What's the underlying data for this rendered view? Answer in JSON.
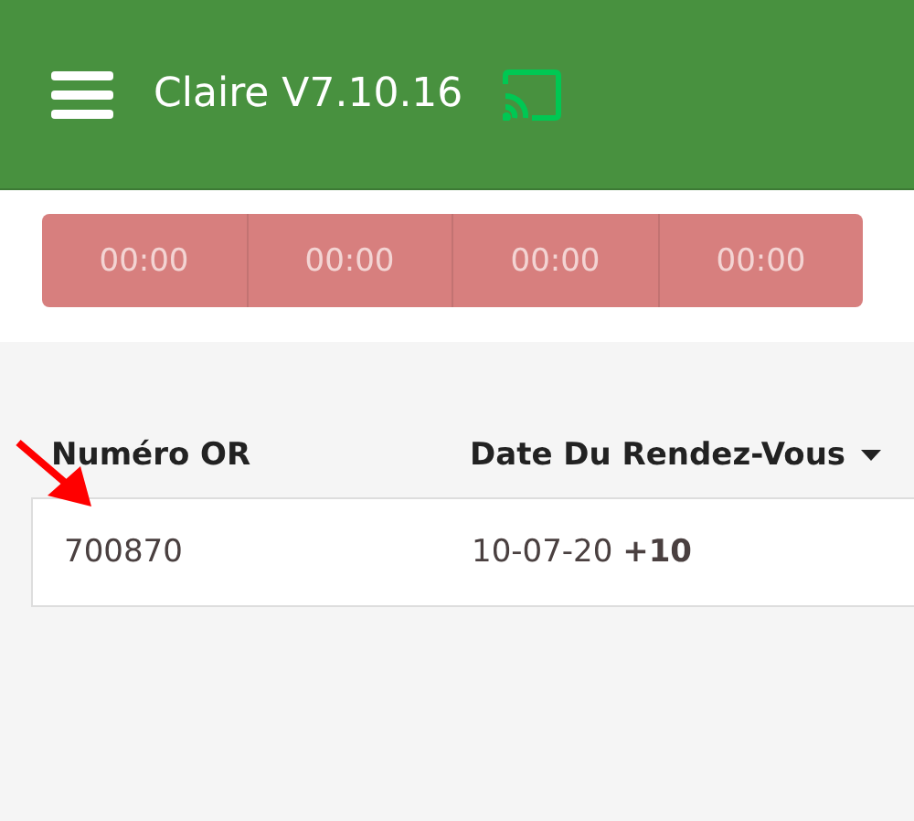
{
  "app_bar": {
    "title": "Claire V7.10.16"
  },
  "timers": [
    "00:00",
    "00:00",
    "00:00",
    "00:00"
  ],
  "table": {
    "columns": [
      "Numéro OR",
      "Date Du Rendez-Vous"
    ],
    "rows": [
      {
        "cells": [
          "700870",
          "10-07-20 **+10**"
        ]
      }
    ]
  }
}
